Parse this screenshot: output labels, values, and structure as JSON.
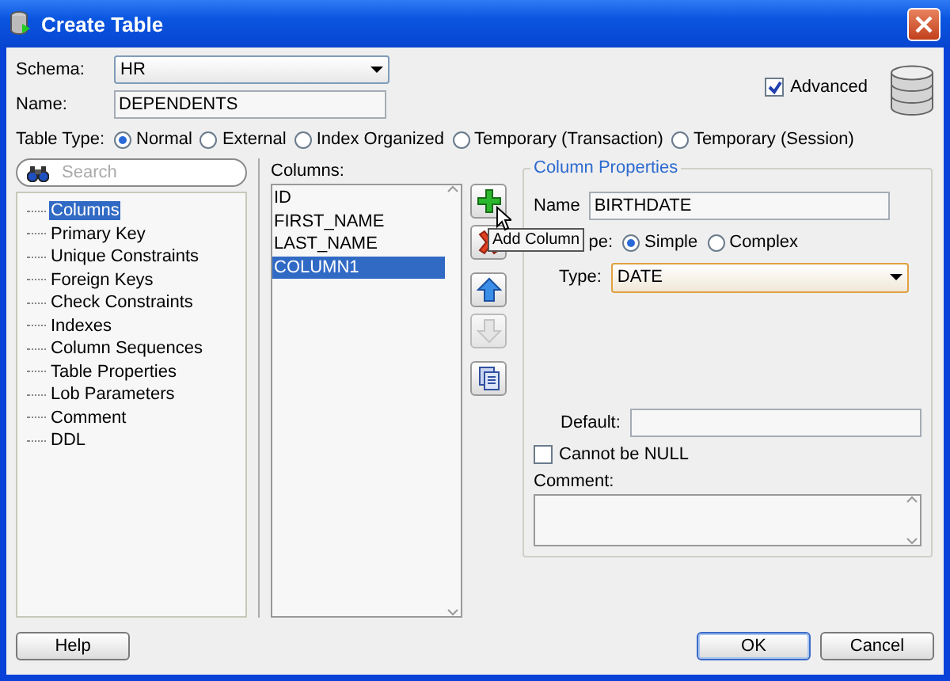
{
  "window": {
    "title": "Create Table"
  },
  "schema": {
    "label": "Schema:",
    "value": "HR"
  },
  "name": {
    "label": "Name:",
    "value": "DEPENDENTS"
  },
  "advanced": {
    "label": "Advanced",
    "checked": true
  },
  "table_type": {
    "label": "Table Type:",
    "options": [
      {
        "label": "Normal",
        "selected": true
      },
      {
        "label": "External",
        "selected": false
      },
      {
        "label": "Index Organized",
        "selected": false
      },
      {
        "label": "Temporary (Transaction)",
        "selected": false
      },
      {
        "label": "Temporary (Session)",
        "selected": false
      }
    ]
  },
  "search": {
    "placeholder": "Search"
  },
  "tree": [
    {
      "label": "Columns",
      "selected": true
    },
    {
      "label": "Primary Key",
      "selected": false
    },
    {
      "label": "Unique Constraints",
      "selected": false
    },
    {
      "label": "Foreign Keys",
      "selected": false
    },
    {
      "label": "Check Constraints",
      "selected": false
    },
    {
      "label": "Indexes",
      "selected": false
    },
    {
      "label": "Column Sequences",
      "selected": false
    },
    {
      "label": "Table Properties",
      "selected": false
    },
    {
      "label": "Lob Parameters",
      "selected": false
    },
    {
      "label": "Comment",
      "selected": false
    },
    {
      "label": "DDL",
      "selected": false
    }
  ],
  "columns": {
    "label": "Columns:",
    "rows": [
      {
        "name": "ID",
        "selected": false
      },
      {
        "name": "FIRST_NAME",
        "selected": false
      },
      {
        "name": "LAST_NAME",
        "selected": false
      },
      {
        "name": "COLUMN1",
        "selected": true
      }
    ]
  },
  "tools": [
    {
      "kind": "add",
      "disabled": false
    },
    {
      "kind": "delete",
      "disabled": false
    },
    {
      "kind": "up",
      "disabled": false
    },
    {
      "kind": "down",
      "disabled": true
    },
    {
      "kind": "copy",
      "disabled": false
    }
  ],
  "tooltip": {
    "text": "Add Column"
  },
  "column_properties": {
    "title": "Column Properties",
    "name": {
      "label": "Name",
      "value": "BIRTHDATE"
    },
    "type_mode": {
      "label": "pe:",
      "options": [
        {
          "label": "Simple",
          "selected": true
        },
        {
          "label": "Complex",
          "selected": false
        }
      ]
    },
    "type": {
      "label": "Type:",
      "value": "DATE"
    },
    "default": {
      "label": "Default:"
    },
    "not_null": {
      "label": "Cannot be NULL",
      "checked": false
    },
    "comment": {
      "label": "Comment:"
    }
  },
  "buttons": [
    {
      "label": "Help",
      "kind": "help"
    },
    {
      "label": "OK",
      "kind": "ok"
    },
    {
      "label": "Cancel",
      "kind": "cancel"
    }
  ]
}
